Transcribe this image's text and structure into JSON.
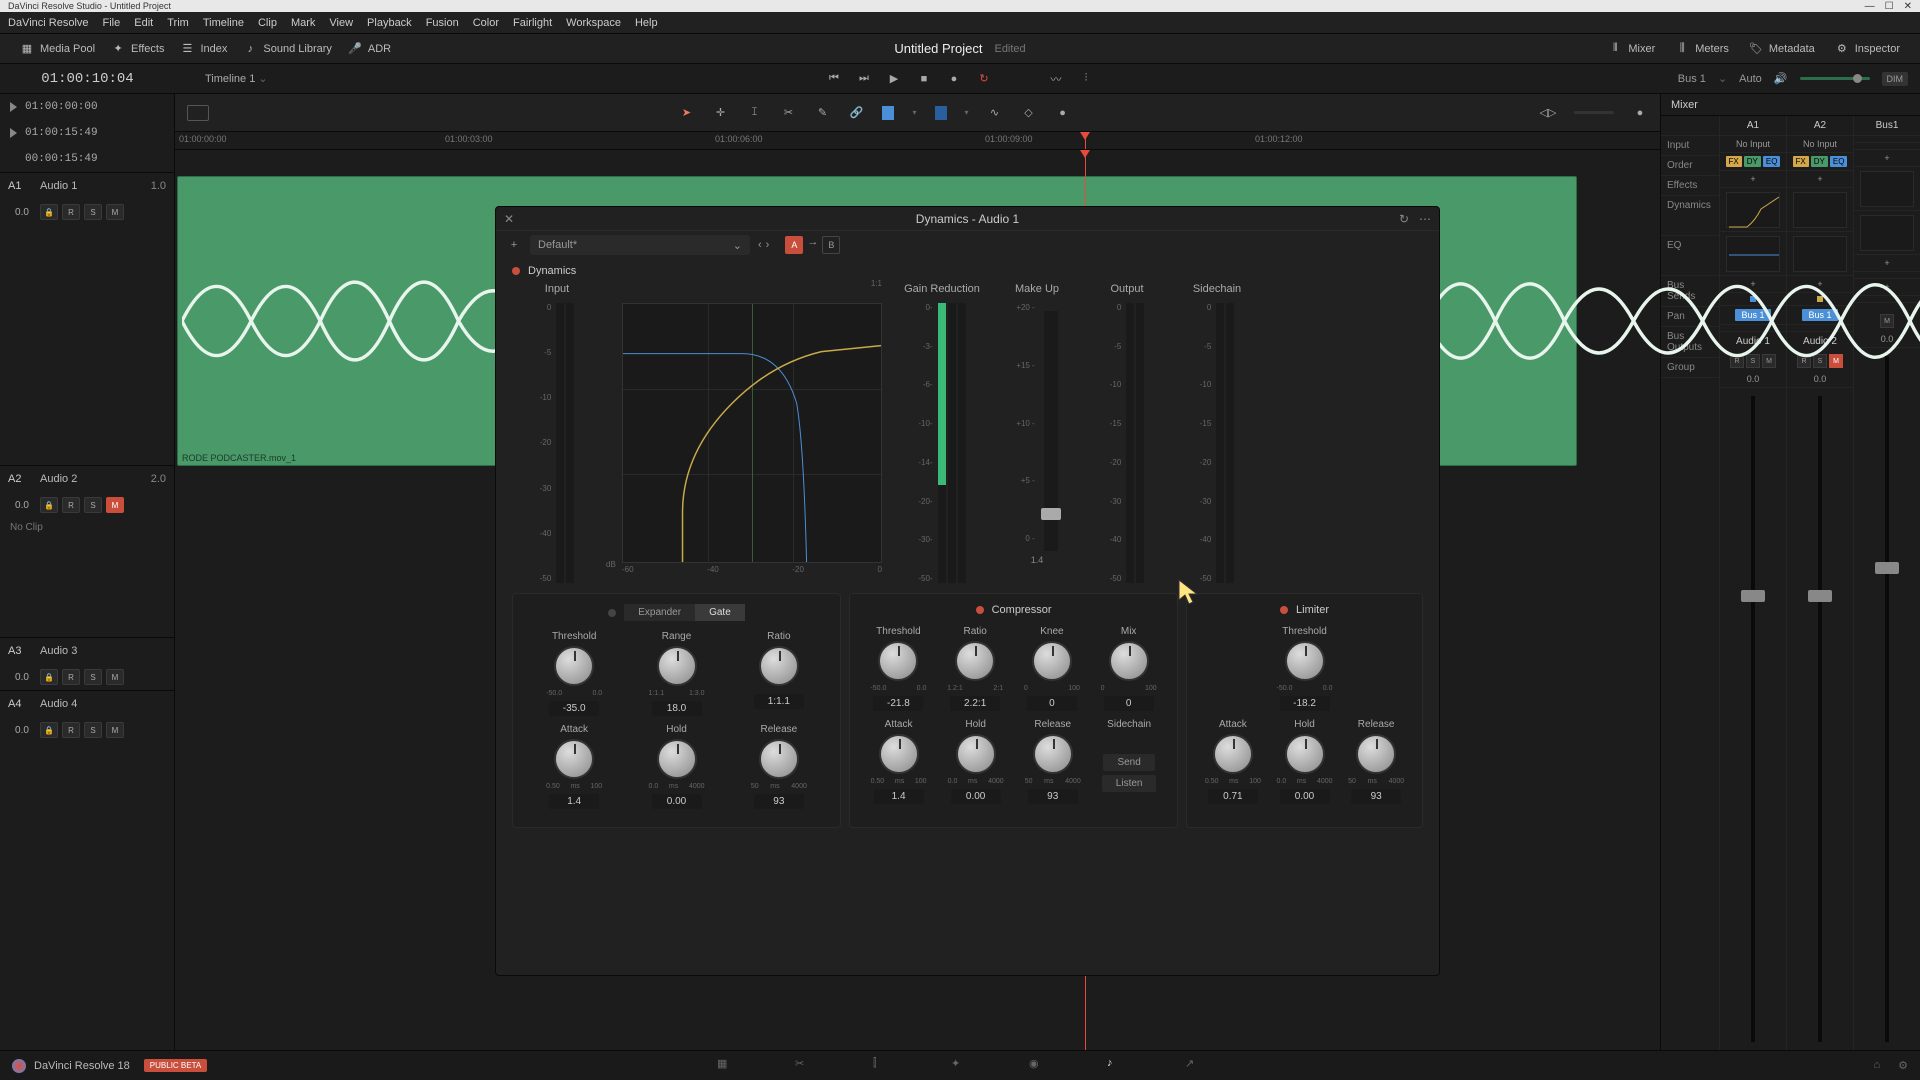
{
  "app": {
    "title": "DaVinci Resolve Studio - Untitled Project"
  },
  "menu": [
    "DaVinci Resolve",
    "File",
    "Edit",
    "Trim",
    "Timeline",
    "Clip",
    "Mark",
    "View",
    "Playback",
    "Fusion",
    "Color",
    "Fairlight",
    "Workspace",
    "Help"
  ],
  "toolbar": {
    "left": [
      {
        "icon": "media-pool-icon",
        "label": "Media Pool"
      },
      {
        "icon": "effects-icon",
        "label": "Effects"
      },
      {
        "icon": "index-icon",
        "label": "Index"
      },
      {
        "icon": "sound-library-icon",
        "label": "Sound Library"
      },
      {
        "icon": "adr-icon",
        "label": "ADR"
      }
    ],
    "project_name": "Untitled Project",
    "project_status": "Edited",
    "right": [
      {
        "icon": "mixer-icon",
        "label": "Mixer"
      },
      {
        "icon": "meters-icon",
        "label": "Meters"
      },
      {
        "icon": "metadata-icon",
        "label": "Metadata"
      },
      {
        "icon": "inspector-icon",
        "label": "Inspector"
      }
    ]
  },
  "timecode": {
    "main": "01:00:10:04",
    "timeline_name": "Timeline 1",
    "bus": "Bus 1",
    "auto": "Auto",
    "dim": "DIM"
  },
  "markers": [
    {
      "tc": "01:00:00:00"
    },
    {
      "tc": "01:00:15:49"
    },
    {
      "tc": "00:00:15:49"
    }
  ],
  "ruler": [
    "01:00:00:00",
    "01:00:03:00",
    "01:00:06:00",
    "01:00:09:00",
    "01:00:12:00"
  ],
  "tracks": [
    {
      "id": "A1",
      "name": "Audio 1",
      "num": "1.0",
      "val": "0.0",
      "clip": "RODE PODCASTER.mov_1",
      "mute": false
    },
    {
      "id": "A2",
      "name": "Audio 2",
      "num": "2.0",
      "val": "0.0",
      "clip": null,
      "noclip": "No Clip",
      "mute": true
    },
    {
      "id": "A3",
      "name": "Audio 3",
      "num": "",
      "val": "0.0",
      "clip": null,
      "mute": false
    },
    {
      "id": "A4",
      "name": "Audio 4",
      "num": "",
      "val": "0.0",
      "clip": null,
      "mute": false
    }
  ],
  "dynamics": {
    "title": "Dynamics - Audio 1",
    "preset": "Default*",
    "ab_active": "A",
    "section": "Dynamics",
    "meters": {
      "input": {
        "label": "Input",
        "scale": [
          "0",
          "-5",
          "-10",
          "-20",
          "-30",
          "-40",
          "-50"
        ],
        "ratio_label": "1:1"
      },
      "gain_reduction": {
        "label": "Gain Reduction",
        "scale": [
          "0-",
          "-3-",
          "-6-",
          "-10-",
          "-14-",
          "-20-",
          "-30-",
          "-50-"
        ]
      },
      "makeup": {
        "label": "Make Up",
        "scale": [
          "+20 -",
          "+15 -",
          "+10 -",
          "+5 -",
          "0 -"
        ],
        "value": "1.4"
      },
      "output": {
        "label": "Output",
        "scale": [
          "0",
          "-5",
          "-10",
          "-15",
          "-20",
          "-30",
          "-40",
          "-50"
        ]
      },
      "sidechain": {
        "label": "Sidechain",
        "scale": [
          "0",
          "-5",
          "-10",
          "-15",
          "-20",
          "-30",
          "-40",
          "-50"
        ]
      }
    },
    "graph_axis": [
      "-60",
      "-40",
      "-20",
      "0"
    ],
    "graph_db": "dB",
    "expander": {
      "tabs": [
        "Expander",
        "Gate"
      ],
      "active_tab": "Gate",
      "knobs1": [
        {
          "label": "Threshold",
          "range": [
            "-50.0",
            "0.0"
          ],
          "val": "-35.0"
        },
        {
          "label": "Range",
          "range": [
            "1:1.1",
            "1:3.0"
          ],
          "val": "18.0"
        },
        {
          "label": "Ratio",
          "range": [
            "",
            ""
          ],
          "val": "1:1.1"
        }
      ],
      "knobs2": [
        {
          "label": "Attack",
          "range": [
            "0.50",
            "ms",
            "100"
          ],
          "val": "1.4"
        },
        {
          "label": "Hold",
          "range": [
            "0.0",
            "ms",
            "4000"
          ],
          "val": "0.00"
        },
        {
          "label": "Release",
          "range": [
            "50",
            "ms",
            "4000"
          ],
          "val": "93"
        }
      ]
    },
    "compressor": {
      "name": "Compressor",
      "knobs1": [
        {
          "label": "Threshold",
          "range": [
            "-50.0",
            "0.0"
          ],
          "val": "-21.8"
        },
        {
          "label": "Ratio",
          "range": [
            "1.2:1",
            "2:1"
          ],
          "val": "2.2:1"
        },
        {
          "label": "Knee",
          "range": [
            "0",
            "100"
          ],
          "val": "0"
        },
        {
          "label": "Mix",
          "range": [
            "0",
            "100"
          ],
          "val": "0"
        }
      ],
      "knobs2": [
        {
          "label": "Attack",
          "range": [
            "0.50",
            "ms",
            "100"
          ],
          "val": "1.4"
        },
        {
          "label": "Hold",
          "range": [
            "0.0",
            "ms",
            "4000"
          ],
          "val": "0.00"
        },
        {
          "label": "Release",
          "range": [
            "50",
            "ms",
            "4000"
          ],
          "val": "93"
        },
        {
          "label": "Sidechain",
          "send": "Send",
          "listen": "Listen"
        }
      ]
    },
    "limiter": {
      "name": "Limiter",
      "knobs1": [
        {
          "label": "Threshold",
          "range": [
            "-50.0",
            "0.0"
          ],
          "val": "-18.2"
        }
      ],
      "knobs2": [
        {
          "label": "Attack",
          "range": [
            "0.50",
            "ms",
            "100"
          ],
          "val": "0.71"
        },
        {
          "label": "Hold",
          "range": [
            "0.0",
            "ms",
            "4000"
          ],
          "val": "0.00"
        },
        {
          "label": "Release",
          "range": [
            "50",
            "ms",
            "4000"
          ],
          "val": "93"
        }
      ]
    }
  },
  "mixer": {
    "title": "Mixer",
    "labels": [
      "Input",
      "Order",
      "Effects",
      "Dynamics",
      "EQ",
      "Bus Sends",
      "Pan",
      "Bus Outputs",
      "Group"
    ],
    "strips": [
      {
        "id": "A1",
        "input": "No Input",
        "name": "Audio 1",
        "val": "0.0",
        "bus": "Bus 1",
        "mute": false
      },
      {
        "id": "A2",
        "input": "No Input",
        "name": "Audio 2",
        "val": "0.0",
        "bus": "Bus 1",
        "mute": true
      },
      {
        "id": "Bus1",
        "input": "",
        "name": "",
        "val": "0.0",
        "bus": "",
        "mute": false
      }
    ]
  },
  "bottom": {
    "app": "DaVinci Resolve 18",
    "beta": "PUBLIC BETA"
  }
}
